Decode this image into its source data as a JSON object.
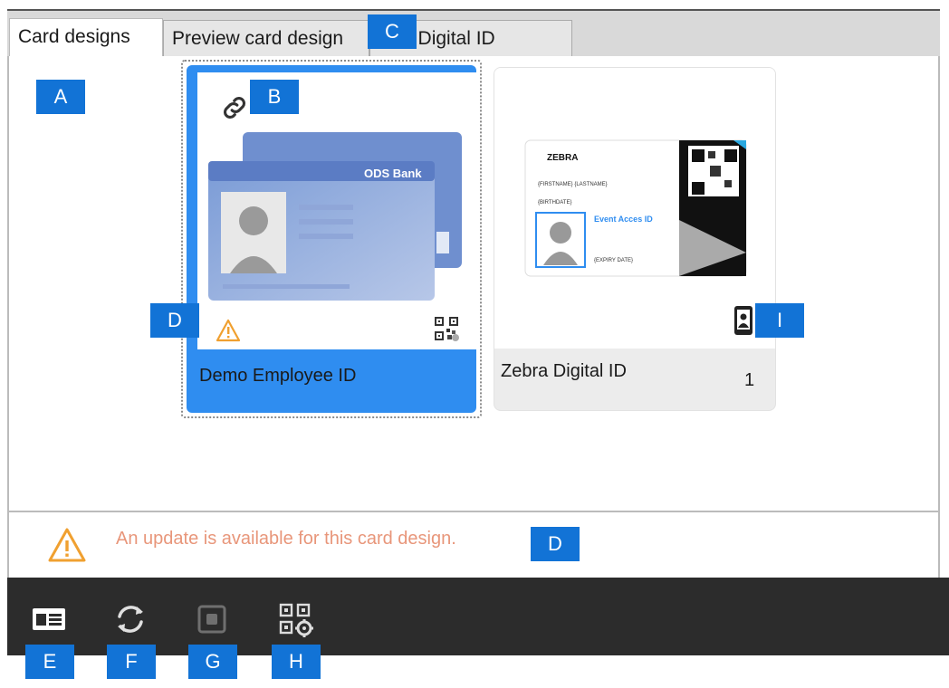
{
  "tabs": [
    {
      "label": "Card designs"
    },
    {
      "label": "Preview card design"
    },
    {
      "label": "Preview Digital ID"
    }
  ],
  "cards": [
    {
      "label": "Demo Employee ID",
      "bank_name": "ODS Bank"
    },
    {
      "label": "Zebra Digital ID",
      "count": "1",
      "brand": "ZEBRA",
      "event_text": "Event Acces ID",
      "name_field": "{FIRSTNAME} {LASTNAME}",
      "birth_field": "{BIRTHDATE}",
      "expiry_field": "{EXPIRY DATE}"
    }
  ],
  "status": {
    "message": "An update is available for this card design."
  },
  "markers": {
    "a": "A",
    "b": "B",
    "c": "C",
    "d1": "D",
    "d2": "D",
    "e": "E",
    "f": "F",
    "g": "G",
    "h": "H",
    "i": "I"
  },
  "colors": {
    "accent": "#2f8df0",
    "warning": "#f0a030",
    "warning_text": "#e8967a",
    "marker": "#1273d6"
  }
}
